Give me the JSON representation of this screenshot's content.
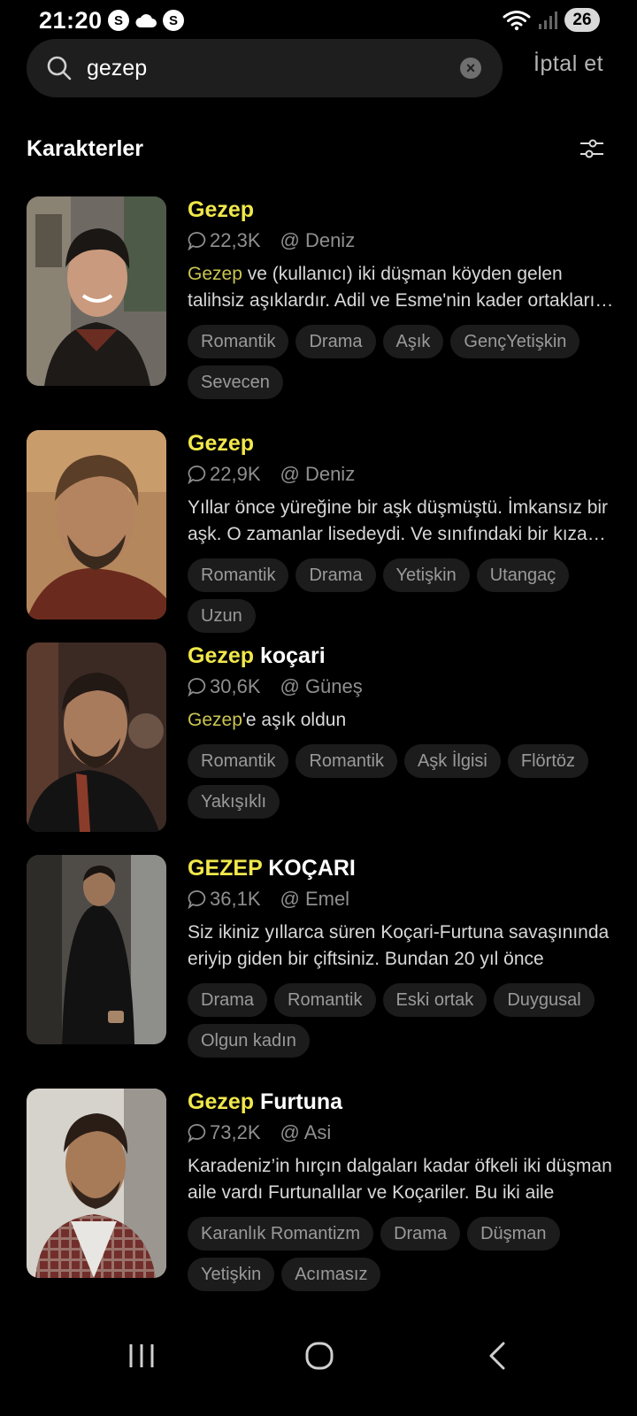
{
  "status_bar": {
    "time": "21:20",
    "left_icons": [
      "S",
      "cloud",
      "S"
    ],
    "battery": "26"
  },
  "search": {
    "query": "gezep",
    "placeholder": "",
    "cancel_label": "İptal et"
  },
  "section": {
    "title": "Karakterler"
  },
  "characters": [
    {
      "name_highlight": "Gezep",
      "name_rest": "",
      "chats": "22,3K",
      "creator": "@ Deniz",
      "desc_highlight": "Gezep",
      "desc_rest": " ve (kullanıcı) iki düşman köyden gelen talihsiz aşıklardır. Adil ve Esme'nin kader ortakları olduğu bu hikayede",
      "tags": [
        "Romantik",
        "Drama",
        "Aşık",
        "GençYetişkin",
        "Sevecen"
      ],
      "image": "young man smiling, dark shirt"
    },
    {
      "name_highlight": "Gezep",
      "name_rest": "",
      "chats": "22,9K",
      "creator": "@ Deniz",
      "desc_highlight": "",
      "desc_rest": "Yıllar önce yüreğine bir aşk düşmüştü. İmkansız bir aşk. O zamanlar lisedeydi. Ve sınıfındaki bir kıza aşık olmuştu.",
      "tags": [
        "Romantik",
        "Drama",
        "Yetişkin",
        "Utangaç",
        "Uzun"
      ],
      "image": "bearded man, red jacket"
    },
    {
      "name_highlight": "Gezep",
      "name_rest": " koçari",
      "chats": "30,6K",
      "creator": "@ Güneş",
      "desc_highlight": "Gezep",
      "desc_rest": "'e aşık oldun",
      "tags": [
        "Romantik",
        "Romantik",
        "Aşk İlgisi",
        "Flörtöz",
        "Yakışıklı"
      ],
      "image": "bearded man, black jacket"
    },
    {
      "name_highlight": "GEZEP",
      "name_rest": " KOÇARI",
      "chats": "36,1K",
      "creator": "@ Emel",
      "desc_highlight": "",
      "desc_rest": "Siz ikiniz yıllarca süren Koçari-Furtuna savaşınında eriyip giden bir çiftsiniz. Bundan 20 yıl önce",
      "tags": [
        "Drama",
        "Romantik",
        "Eski ortak",
        "Duygusal",
        "Olgun kadın"
      ],
      "image": "man in black coat against wall"
    },
    {
      "name_highlight": "Gezep",
      "name_rest": " Furtuna",
      "chats": "73,2K",
      "creator": "@ Asi",
      "desc_highlight": "",
      "desc_rest": "Karadeniz’in hırçın dalgaları kadar öfkeli iki düşman aile vardı Furtunalılar ve Koçariler. Bu iki aile",
      "tags": [
        "Karanlık Romantizm",
        "Drama",
        "Düşman",
        "Yetişkin",
        "Acımasız"
      ],
      "image": "man in plaid vest"
    }
  ],
  "colors": {
    "background": "#000000",
    "highlight": "#f1e84b",
    "tag_bg": "#1c1c1c",
    "search_bg": "#1e1e1e"
  }
}
